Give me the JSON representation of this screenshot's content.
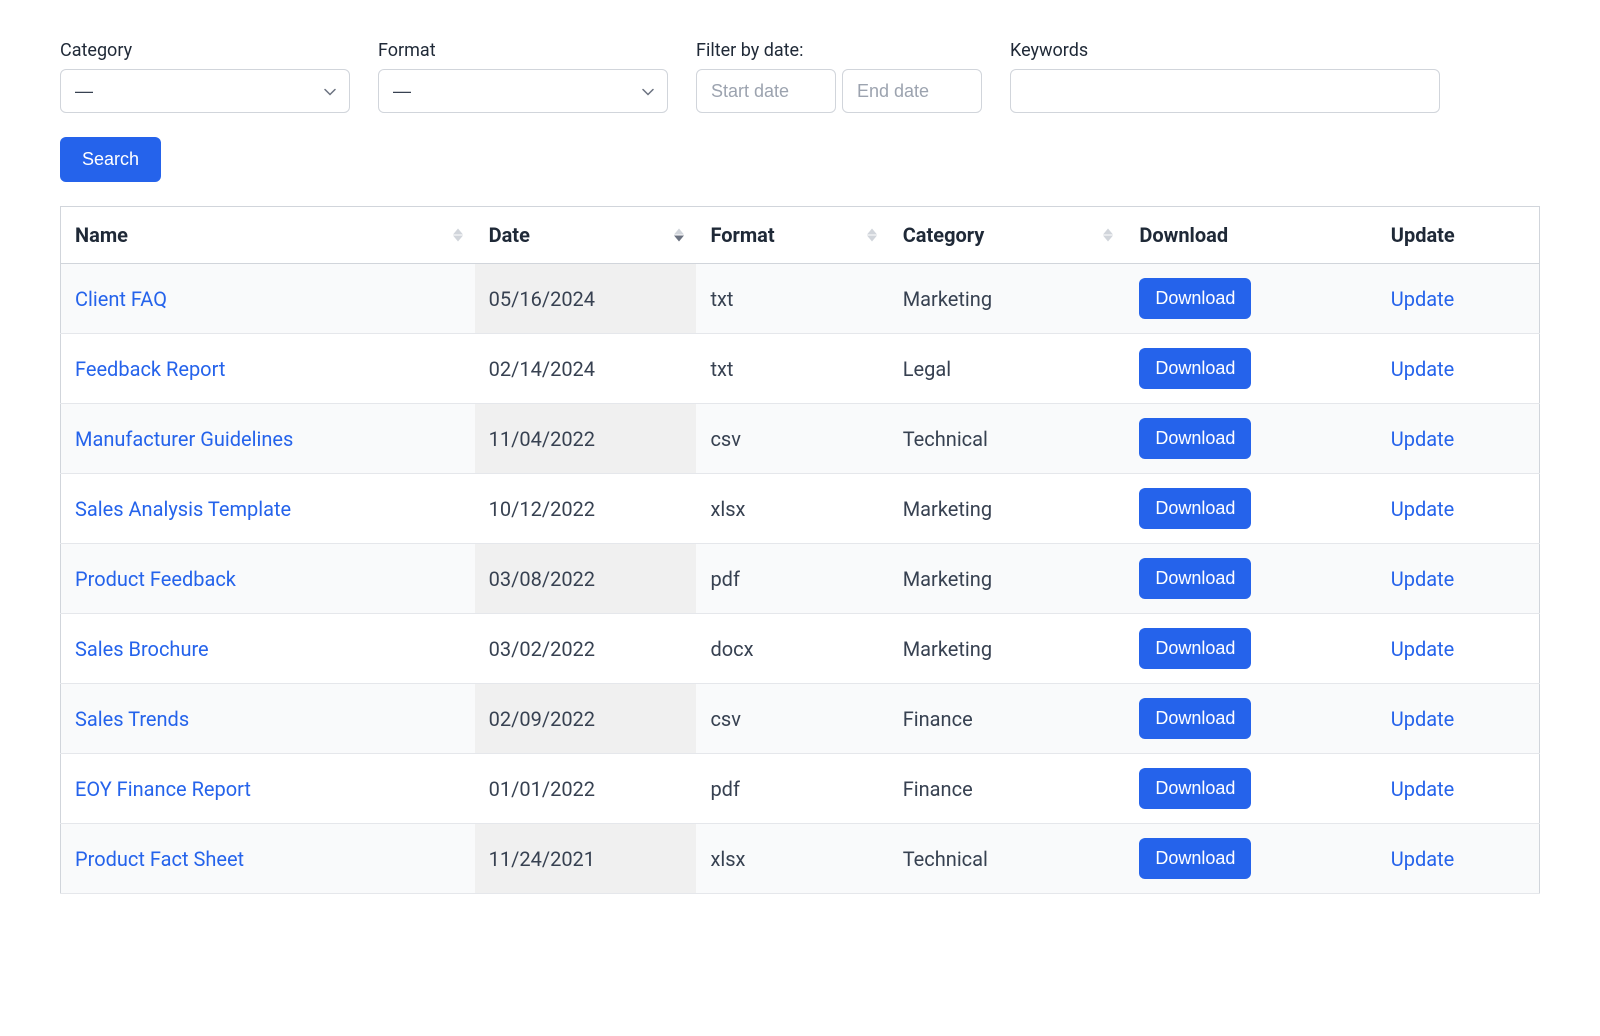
{
  "filters": {
    "category": {
      "label": "Category",
      "value": "—"
    },
    "format": {
      "label": "Format",
      "value": "—"
    },
    "date": {
      "label": "Filter by date:",
      "start_placeholder": "Start date",
      "end_placeholder": "End date"
    },
    "keywords": {
      "label": "Keywords"
    }
  },
  "search_button": "Search",
  "table": {
    "columns": {
      "name": "Name",
      "date": "Date",
      "format": "Format",
      "category": "Category",
      "download": "Download",
      "update": "Update"
    },
    "download_label": "Download",
    "update_label": "Update",
    "rows": [
      {
        "name": "Client FAQ",
        "date": "05/16/2024",
        "format": "txt",
        "category": "Marketing"
      },
      {
        "name": "Feedback Report",
        "date": "02/14/2024",
        "format": "txt",
        "category": "Legal"
      },
      {
        "name": "Manufacturer Guidelines",
        "date": "11/04/2022",
        "format": "csv",
        "category": "Technical"
      },
      {
        "name": "Sales Analysis Template",
        "date": "10/12/2022",
        "format": "xlsx",
        "category": "Marketing"
      },
      {
        "name": "Product Feedback",
        "date": "03/08/2022",
        "format": "pdf",
        "category": "Marketing"
      },
      {
        "name": "Sales Brochure",
        "date": "03/02/2022",
        "format": "docx",
        "category": "Marketing"
      },
      {
        "name": "Sales Trends",
        "date": "02/09/2022",
        "format": "csv",
        "category": "Finance"
      },
      {
        "name": "EOY Finance Report",
        "date": "01/01/2022",
        "format": "pdf",
        "category": "Finance"
      },
      {
        "name": "Product Fact Sheet",
        "date": "11/24/2021",
        "format": "xlsx",
        "category": "Technical"
      }
    ]
  }
}
